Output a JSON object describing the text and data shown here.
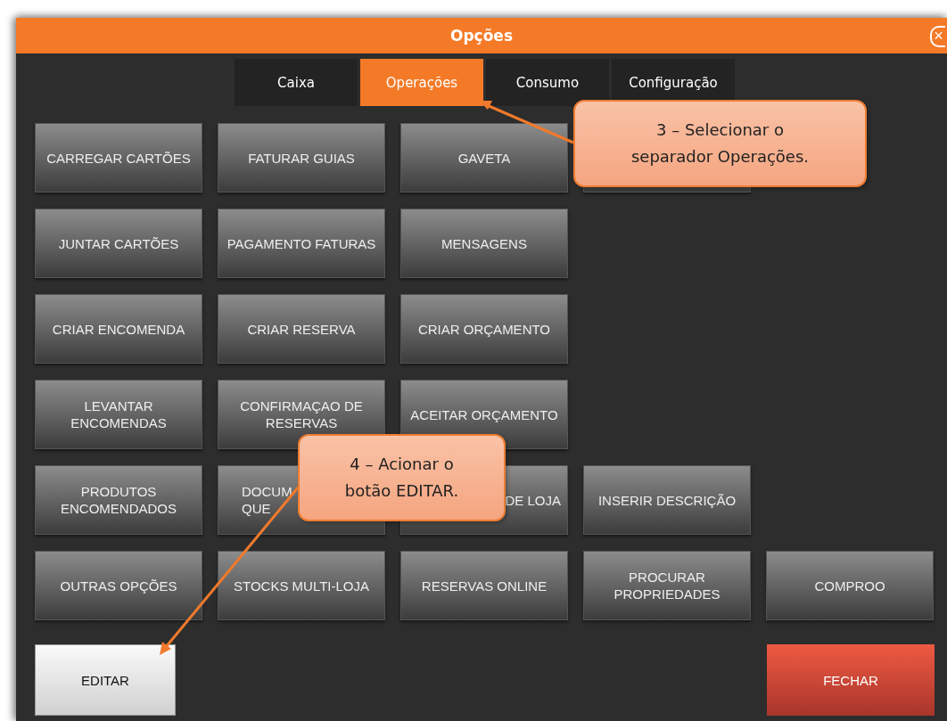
{
  "window": {
    "title": "Opções",
    "close": "×"
  },
  "tabs": [
    {
      "label": "Caixa",
      "selected": false
    },
    {
      "label": "Operações",
      "selected": true
    },
    {
      "label": "Consumo",
      "selected": false
    },
    {
      "label": "Configuração",
      "selected": false
    }
  ],
  "grid": [
    [
      {
        "kind": "button",
        "lines": [
          "CARREGAR CARTÕES"
        ]
      },
      {
        "kind": "button",
        "lines": [
          "FATURAR GUIAS"
        ]
      },
      {
        "kind": "button",
        "lines": [
          "GAVETA"
        ]
      },
      {
        "kind": "covered"
      }
    ],
    [
      {
        "kind": "button",
        "lines": [
          "JUNTAR CARTÕES"
        ]
      },
      {
        "kind": "button",
        "lines": [
          "PAGAMENTO FATURAS"
        ]
      },
      {
        "kind": "button",
        "lines": [
          "MENSAGENS"
        ]
      }
    ],
    [
      {
        "kind": "button",
        "lines": [
          "CRIAR ENCOMENDA"
        ]
      },
      {
        "kind": "button",
        "lines": [
          "CRIAR RESERVA"
        ]
      },
      {
        "kind": "button",
        "lines": [
          "CRIAR ORÇAMENTO"
        ]
      }
    ],
    [
      {
        "kind": "button",
        "lines": [
          "LEVANTAR",
          "ENCOMENDAS"
        ]
      },
      {
        "kind": "button",
        "lines": [
          "CONFIRMAÇAO DE",
          "RESERVAS"
        ]
      },
      {
        "kind": "button",
        "lines": [
          "ACEITAR ORÇAMENTO"
        ]
      }
    ],
    [
      {
        "kind": "button",
        "lines": [
          "PRODUTOS",
          "ENCOMENDADOS"
        ]
      },
      {
        "kind": "partial-left",
        "lines": [
          "DOCUM",
          "QUE"
        ]
      },
      {
        "kind": "partial-right",
        "lines": [
          "DE LOJA"
        ]
      },
      {
        "kind": "button",
        "lines": [
          "INSERIR DESCRIÇÃO"
        ]
      }
    ],
    [
      {
        "kind": "button",
        "lines": [
          "OUTRAS OPÇÕES"
        ]
      },
      {
        "kind": "button",
        "lines": [
          "STOCKS MULTI-LOJA"
        ]
      },
      {
        "kind": "button",
        "lines": [
          "RESERVAS ONLINE"
        ]
      },
      {
        "kind": "button",
        "lines": [
          "PROCURAR",
          "PROPRIEDADES"
        ]
      },
      {
        "kind": "button",
        "lines": [
          "COMPROO"
        ]
      }
    ]
  ],
  "footer": {
    "edit": "EDITAR",
    "close": "FECHAR"
  },
  "callouts": [
    {
      "kind": "tab",
      "text": "3 – Selecionar o separador Operações."
    },
    {
      "kind": "edit",
      "text": "4 – Acionar o botão EDITAR."
    }
  ]
}
